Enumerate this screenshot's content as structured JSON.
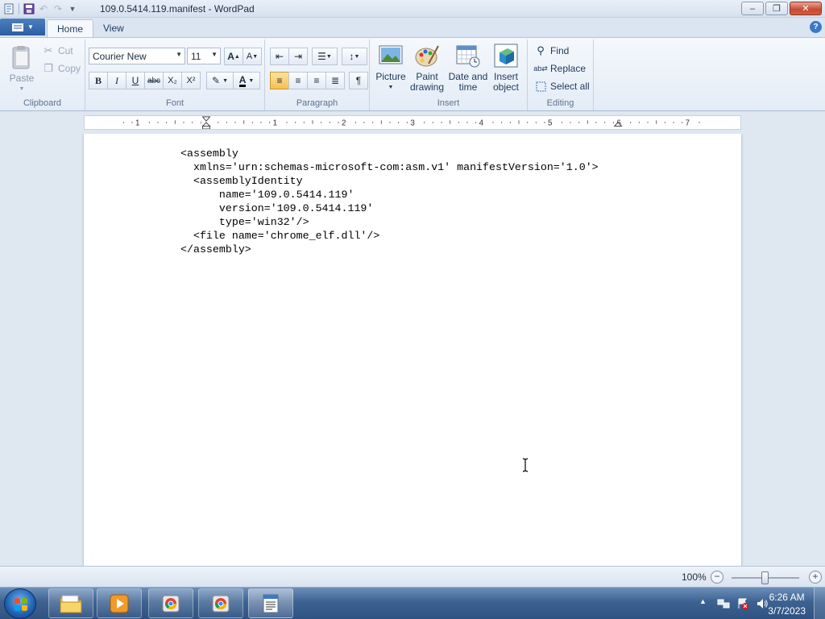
{
  "window": {
    "title": "109.0.5414.119.manifest - WordPad",
    "minimize_label": "–",
    "restore_label": "❐",
    "close_label": "✕"
  },
  "ribbon_tabs": {
    "home": "Home",
    "view": "View"
  },
  "clipboard": {
    "paste": "Paste",
    "cut": "Cut",
    "copy": "Copy",
    "label": "Clipboard"
  },
  "font": {
    "family": "Courier New",
    "size": "11",
    "label": "Font",
    "bold": "B",
    "italic": "I",
    "underline": "U",
    "strike": "abc",
    "subscript": "X₂",
    "superscript": "X²"
  },
  "paragraph": {
    "label": "Paragraph"
  },
  "insert": {
    "picture": "Picture",
    "paint_drawing": "Paint drawing",
    "date_time": "Date and time",
    "insert_object": "Insert object",
    "label": "Insert"
  },
  "editing": {
    "find": "Find",
    "replace": "Replace",
    "select_all": "Select all",
    "label": "Editing"
  },
  "ruler": {
    "numbers": [
      "1",
      "1",
      "2",
      "3",
      "4",
      "5",
      "6",
      "7"
    ]
  },
  "document": {
    "lines": [
      "<assembly",
      "  xmlns='urn:schemas-microsoft-com:asm.v1' manifestVersion='1.0'>",
      "  <assemblyIdentity",
      "      name='109.0.5414.119'",
      "      version='109.0.5414.119'",
      "      type='win32'/>",
      "  <file name='chrome_elf.dll'/>",
      "</assembly>"
    ]
  },
  "status": {
    "zoom": "100%",
    "zoom_out": "−",
    "zoom_in": "+",
    "zoom_level": 0.5
  },
  "taskbar": {
    "time": "6:26 AM",
    "date": "3/7/2023"
  }
}
